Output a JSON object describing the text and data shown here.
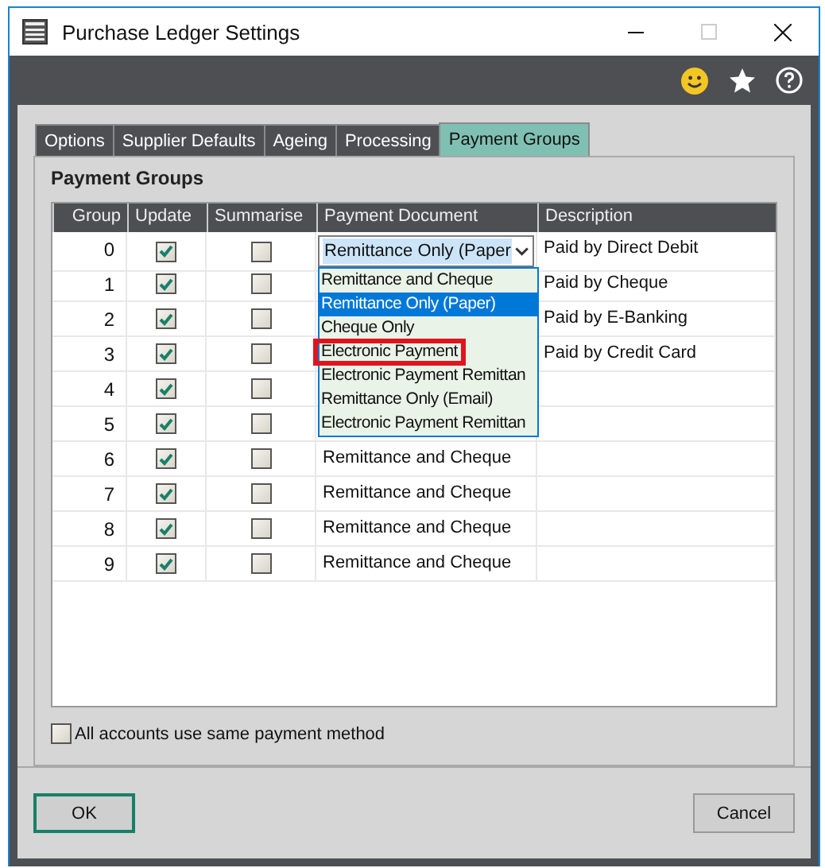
{
  "window": {
    "title": "Purchase Ledger Settings"
  },
  "tabs": [
    {
      "label": "Options",
      "selected": false
    },
    {
      "label": "Supplier Defaults",
      "selected": false
    },
    {
      "label": "Ageing",
      "selected": false
    },
    {
      "label": "Processing",
      "selected": false
    },
    {
      "label": "Payment Groups",
      "selected": true
    }
  ],
  "group_title": "Payment Groups",
  "table": {
    "columns": [
      "Group",
      "Update",
      "Summarise",
      "Payment Document",
      "Description"
    ],
    "rows": [
      {
        "group": "0",
        "update": true,
        "summarise": false,
        "payment_document": "Remittance Only (Paper",
        "description": "Paid by Direct Debit"
      },
      {
        "group": "1",
        "update": true,
        "summarise": false,
        "description": "Paid by Cheque"
      },
      {
        "group": "2",
        "update": true,
        "summarise": false,
        "description": "Paid by E-Banking"
      },
      {
        "group": "3",
        "update": true,
        "summarise": false,
        "description": "Paid by Credit Card"
      },
      {
        "group": "4",
        "update": true,
        "summarise": false
      },
      {
        "group": "5",
        "update": true,
        "summarise": false
      },
      {
        "group": "6",
        "update": true,
        "summarise": false,
        "payment_document": "Remittance and Cheque"
      },
      {
        "group": "7",
        "update": true,
        "summarise": false,
        "payment_document": "Remittance and Cheque"
      },
      {
        "group": "8",
        "update": true,
        "summarise": false,
        "payment_document": "Remittance and Cheque"
      },
      {
        "group": "9",
        "update": true,
        "summarise": false,
        "payment_document": "Remittance and Cheque"
      }
    ]
  },
  "dropdown": {
    "options": [
      {
        "label": "Remittance and Cheque",
        "selected": false,
        "highlighted": false
      },
      {
        "label": "Remittance Only (Paper)",
        "selected": true,
        "highlighted": false
      },
      {
        "label": "Cheque Only",
        "selected": false,
        "highlighted": false
      },
      {
        "label": "Electronic Payment",
        "selected": false,
        "highlighted": true
      },
      {
        "label": "Electronic Payment Remittan",
        "selected": false,
        "highlighted": false
      },
      {
        "label": "Remittance Only (Email)",
        "selected": false,
        "highlighted": false
      },
      {
        "label": "Electronic Payment Remittan",
        "selected": false,
        "highlighted": false
      }
    ]
  },
  "same_method": {
    "label": "All accounts use same payment method",
    "checked": false
  },
  "buttons": [
    {
      "label": "OK",
      "default": true
    },
    {
      "label": "Cancel",
      "default": false
    }
  ]
}
